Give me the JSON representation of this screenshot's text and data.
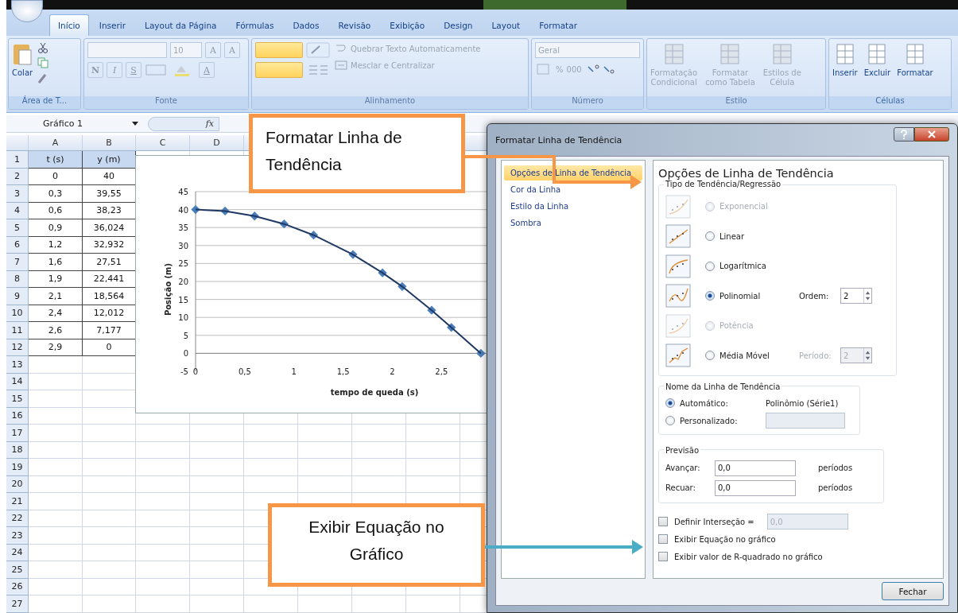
{
  "tabs": [
    {
      "label": "Início",
      "selected": true
    },
    {
      "label": "Inserir",
      "selected": false
    },
    {
      "label": "Layout da Página",
      "selected": false
    },
    {
      "label": "Fórmulas",
      "selected": false
    },
    {
      "label": "Dados",
      "selected": false
    },
    {
      "label": "Revisão",
      "selected": false
    },
    {
      "label": "Exibição",
      "selected": false
    },
    {
      "label": "Design",
      "selected": false
    },
    {
      "label": "Layout",
      "selected": false
    },
    {
      "label": "Formatar",
      "selected": false
    }
  ],
  "ribbon": {
    "clipboard": {
      "label": "Área de T...",
      "paste": "Colar"
    },
    "font": {
      "label": "Fonte",
      "disabled": true,
      "size": "10",
      "grow": "A",
      "shrink": "A",
      "bold": "N",
      "italic": "I",
      "underline": "S",
      "font_color_button": "A"
    },
    "alignment": {
      "label": "Alinhamento",
      "disabled": true,
      "wrap": "Quebrar Texto Automaticamente",
      "merge": "Mesclar e Centralizar"
    },
    "number": {
      "label": "Número",
      "disabled": true,
      "format": "Geral",
      "percent": "%",
      "thousands": "000"
    },
    "styles": {
      "label": "Estilo",
      "disabled": true,
      "buttons": [
        {
          "line1": "Formatação",
          "line2": "Condicional"
        },
        {
          "line1": "Formatar",
          "line2": "como Tabela"
        },
        {
          "line1": "Estilos de",
          "line2": "Célula"
        }
      ]
    },
    "cells": {
      "label": "Células",
      "disabled": false,
      "buttons": [
        "Inserir",
        "Excluir",
        "Formatar"
      ]
    }
  },
  "formula_bar": {
    "name_box": "Gráfico 1",
    "function_label": "fx"
  },
  "sheet": {
    "columns": [
      "A",
      "B",
      "C",
      "D"
    ],
    "rows": [
      {
        "number": "1",
        "cells": [
          "t (s)",
          "y (m)"
        ],
        "header": true
      },
      {
        "number": "2",
        "cells": [
          "0",
          "40"
        ]
      },
      {
        "number": "3",
        "cells": [
          "0,3",
          "39,55"
        ]
      },
      {
        "number": "4",
        "cells": [
          "0,6",
          "38,23"
        ]
      },
      {
        "number": "5",
        "cells": [
          "0,9",
          "36,024"
        ]
      },
      {
        "number": "6",
        "cells": [
          "1,2",
          "32,932"
        ]
      },
      {
        "number": "7",
        "cells": [
          "1,6",
          "27,51"
        ]
      },
      {
        "number": "8",
        "cells": [
          "1,9",
          "22,441"
        ]
      },
      {
        "number": "9",
        "cells": [
          "2,1",
          "18,564"
        ]
      },
      {
        "number": "10",
        "cells": [
          "2,4",
          "12,012"
        ]
      },
      {
        "number": "11",
        "cells": [
          "2,6",
          "7,177"
        ]
      },
      {
        "number": "12",
        "cells": [
          "2,9",
          "0"
        ]
      },
      {
        "number": "13"
      },
      {
        "number": "14"
      },
      {
        "number": "15"
      },
      {
        "number": "16"
      },
      {
        "number": "17"
      },
      {
        "number": "18"
      },
      {
        "number": "19"
      },
      {
        "number": "20"
      },
      {
        "number": "21"
      },
      {
        "number": "22"
      },
      {
        "number": "23"
      },
      {
        "number": "24"
      },
      {
        "number": "25"
      },
      {
        "number": "26"
      },
      {
        "number": "27"
      }
    ]
  },
  "chart": {
    "chart_data": {
      "type": "line",
      "grid": true,
      "xlim": [
        0,
        2.95
      ],
      "xlabel": "tempo de queda (s)",
      "ylabel": "Posição (m)",
      "x": [
        0,
        0.3,
        0.6,
        0.9,
        1.2,
        1.6,
        1.9,
        2.1,
        2.4,
        2.6,
        2.9
      ],
      "series": [
        {
          "color": "#4a7ebb",
          "marker": "diamond",
          "values": [
            40,
            39.6,
            38.2,
            36.0,
            32.9,
            27.5,
            22.4,
            18.6,
            12.0,
            7.2,
            0
          ]
        }
      ],
      "ylim": [
        -5,
        45
      ],
      "yticks": [
        -5,
        0,
        5,
        10,
        15,
        20,
        25,
        30,
        35,
        40,
        45
      ],
      "xticks": [
        0,
        {
          "value": 0.5,
          "label": "0,5"
        },
        1,
        {
          "value": 1.5,
          "label": "1,5"
        },
        2,
        {
          "value": 2.5,
          "label": "2,5"
        }
      ]
    }
  },
  "dialog": {
    "title": "Formatar Linha de Tendência",
    "nav": [
      {
        "label": "Opções de Linha de Tendência",
        "selected": true
      },
      {
        "label": "Cor da Linha",
        "selected": false
      },
      {
        "label": "Estilo da Linha",
        "selected": false
      },
      {
        "label": "Sombra",
        "selected": false
      }
    ],
    "heading": "Opções de Linha de Tendência",
    "type_group": {
      "legend": "Tipo de Tendência/Regressão",
      "options": [
        {
          "kind": "exponential",
          "label": "Exponencial",
          "selected": false,
          "disabled": true
        },
        {
          "kind": "linear",
          "label": "Linear",
          "selected": false,
          "disabled": false
        },
        {
          "kind": "logarithmic",
          "label": "Logarítmica",
          "selected": false,
          "disabled": false
        },
        {
          "kind": "polynomial",
          "label": "Polinomial",
          "selected": true,
          "disabled": false,
          "extra": {
            "label": "Ordem:",
            "value": "2",
            "disabled": false
          }
        },
        {
          "kind": "power",
          "label": "Potência",
          "selected": false,
          "disabled": true
        },
        {
          "kind": "moving_average",
          "label": "Média Móvel",
          "selected": false,
          "disabled": false,
          "extra": {
            "label": "Período:",
            "value": "2",
            "disabled": true
          }
        }
      ]
    },
    "name_group": {
      "legend": "Nome da Linha de Tendência",
      "options": [
        {
          "kind": "auto",
          "label": "Automático:",
          "selected": true,
          "value": "Polinômio (Série1)"
        },
        {
          "kind": "custom",
          "label": "Personalizado:",
          "selected": false
        }
      ]
    },
    "forecast_group": {
      "legend": "Previsão",
      "rows": [
        {
          "label": "Avançar:",
          "value": "0,0",
          "unit": "períodos"
        },
        {
          "label": "Recuar:",
          "value": "0,0",
          "unit": "períodos"
        }
      ]
    },
    "checks": [
      {
        "kind": "intercept",
        "label": "Definir Interseção =",
        "checked": false,
        "value": "0,0"
      },
      {
        "kind": "plain",
        "label": "Exibir Equação no gráfico",
        "checked": false
      },
      {
        "kind": "plain",
        "label": "Exibir valor de R-quadrado no gráfico",
        "checked": false
      }
    ],
    "close_button": "Fechar"
  },
  "callouts": [
    {
      "text": "Formatar Linha de Tendência",
      "color": "#f79646"
    },
    {
      "text": "Exibir Equação no Gráfico",
      "color": "#4bacc6"
    }
  ]
}
